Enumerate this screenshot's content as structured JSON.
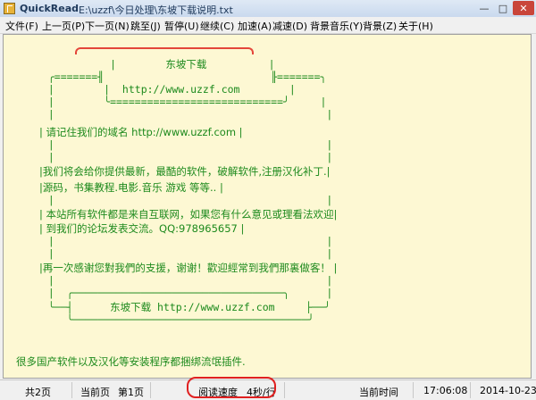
{
  "window": {
    "app_name": "QuickRead",
    "file_path": "E:\\uzzf\\今日处理\\东坡下载说明.txt",
    "min_glyph": "—",
    "max_glyph": "□",
    "close_glyph": "✕"
  },
  "menu": [
    "文件(F)",
    "上一页(P)",
    "下一页(N)",
    "跳至(J)",
    "暂停(U)",
    "继续(C)",
    "加速(A)",
    "减速(D)",
    "背景音乐(Y)",
    "背景(Z)",
    "关于(H)"
  ],
  "content": {
    "art": [
      "            |        东坡下载          |",
      "  ╭=======╢                           ╟=======╮",
      "  |        |  http://www.uzzf.com        |",
      "  |        ╰============================╯     |",
      "  |                                            |",
      "  |    请记住我们的域名 http://www.uzzf.com    |",
      "  |                                            |",
      "  |                                            |",
      "  |我们将会给你提供最新，最酷的软件，破解软件,注册汉化补丁.|",
      "  |源码，书集教程.电影.音乐 游戏 等等..        |",
      "  |                                            |",
      "  |  本站所有软件都是来自互联网，如果您有什么意见或理看法欢迎|",
      "  |  到我们的论坛发表交流。QQ:978965657         |",
      "  |                                            |",
      "  |                                            |",
      "  |再一次感谢您對我們的支援，谢谢！歡迎經常到我們那裏做客！ |",
      "  |                                            |",
      "  |  ╭──────────────────────────────────╮      |",
      "  ╰──┤      东坡下载 http://www.uzzf.com     ├──╯",
      "     ╰──────────────────────────────────────╯"
    ],
    "footer_line": "很多国产软件以及汉化等安装程序都捆绑流氓插件."
  },
  "status": {
    "total_pages": "共2页",
    "current_page_label": "当前页",
    "current_page_value": "第1页",
    "read_speed_label": "阅读速度",
    "read_speed_value": "4秒/行",
    "time_label": "当前时间",
    "time_value": "17:06:08",
    "date_value": "2014-10-23"
  },
  "colors": {
    "text_green": "#1d8a1d",
    "content_bg": "#fdf8d3",
    "highlight_red": "#e02020"
  }
}
